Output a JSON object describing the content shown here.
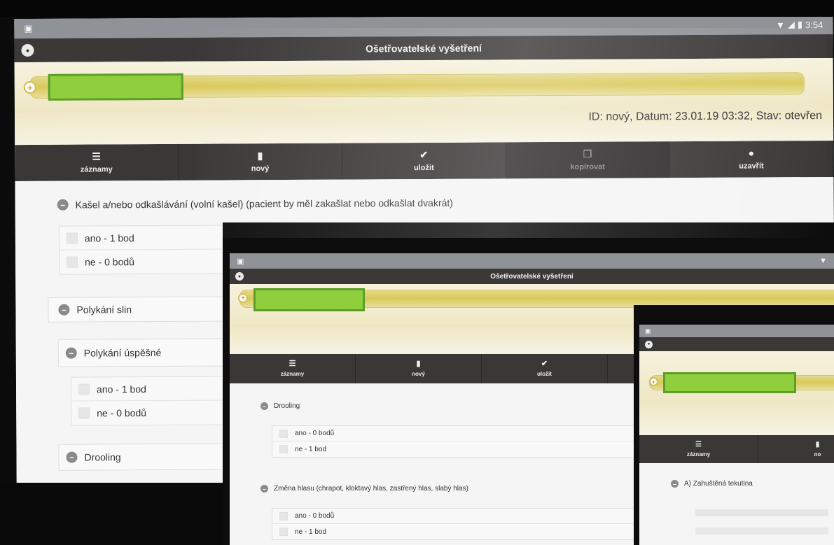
{
  "colors": {
    "statusbar": "#8f9296",
    "appbar": "#3b3838",
    "patient_band": "#efe7c4",
    "redaction": "#8fce3c",
    "toolbar": "#3a3737"
  },
  "statusbar": {
    "time": "3:54",
    "icons": [
      "wifi-icon",
      "signal-icon",
      "battery-icon"
    ]
  },
  "app": {
    "title": "Ošetřovatelské vyšetření"
  },
  "record": {
    "info": "ID: nový, Datum: 23.01.19 03:32, Stav: otevřen"
  },
  "toolbar": {
    "zaznamy": "záznamy",
    "novy": "nový",
    "ulozit": "uložit",
    "kopirovat": "kopírovat",
    "uzavrit": "uzavřít"
  },
  "screen1": {
    "q1_title": "Kašel a/nebo odkašlávání (volní kašel) (pacient by měl zakašlat nebo odkašlat dvakrát)",
    "q1_opt1": "ano - 1 bod",
    "q1_opt2": "ne - 0 bodů",
    "q2_title": "Polykání slin",
    "q2a_title": "Polykání úspěšné",
    "q2a_opt1": "ano - 1 bod",
    "q2a_opt2": "ne - 0 bodů",
    "q3_title": "Drooling"
  },
  "screen2": {
    "q1_title": "Drooling",
    "q1_opt1": "ano - 0 bodů",
    "q1_opt2": "ne - 1 bod",
    "q2_title": "Změna hlasu (chrapot, kloktavý hlas, zastřený hlas, slabý hlas)",
    "q2_opt1": "ano - 0 bodů",
    "q2_opt2": "ne - 1 bod"
  },
  "screen3": {
    "q1_title": "A) Zahuštěná tekutina",
    "toolbar_partial": "no"
  }
}
